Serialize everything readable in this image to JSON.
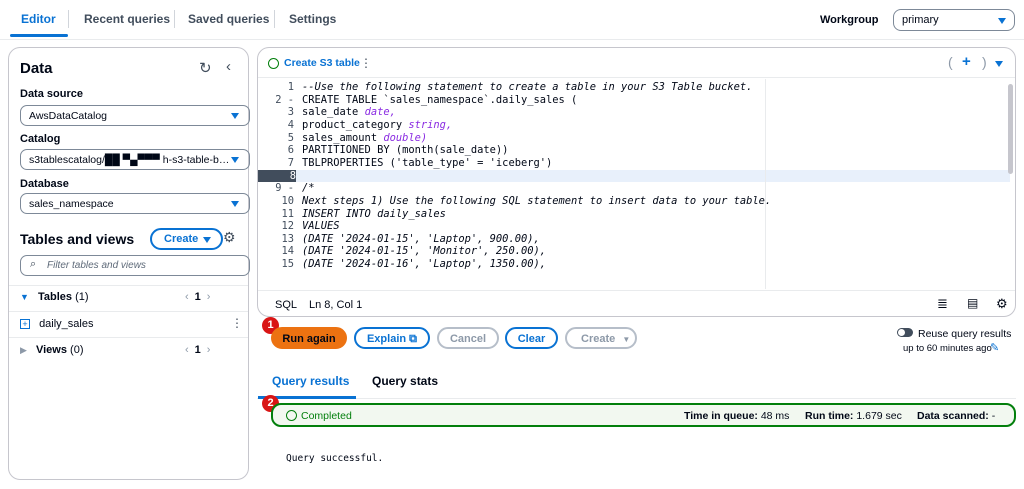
{
  "tabs": [
    "Editor",
    "Recent queries",
    "Saved queries",
    "Settings"
  ],
  "workgroup": {
    "label": "Workgroup",
    "value": "primary"
  },
  "left": {
    "title": "Data",
    "data_source_label": "Data source",
    "data_source": "AwsDataCatalog",
    "catalog_label": "Catalog",
    "catalog": "s3tablescatalog/██ ▀▄▀▀▀ h-s3-table-b…",
    "database_label": "Database",
    "database": "sales_namespace",
    "tables_views_title": "Tables and views",
    "create_label": "Create",
    "filter_placeholder": "Filter tables and views",
    "tables_label": "Tables",
    "tables_count": "(1)",
    "tables_page": "1",
    "table_item": "daily_sales",
    "views_label": "Views",
    "views_count": "(0)",
    "views_page": "1"
  },
  "editor": {
    "tab_label": "Create S3 table",
    "tab_menu": "⋮",
    "add_tab": "+",
    "lines": [
      {
        "n": "1",
        "text": "--Use the following statement to create a table in your S3 Table bucket."
      },
      {
        "n": "2 -",
        "text": "CREATE TABLE `sales_namespace`.daily_sales ("
      },
      {
        "n": "3",
        "text": "sale_date ",
        "type": "date,"
      },
      {
        "n": "4",
        "text": "product_category ",
        "type": "string,"
      },
      {
        "n": "5",
        "text": "sales_amount ",
        "type": "double)"
      },
      {
        "n": "6",
        "text": "PARTITIONED BY (month(sale_date))"
      },
      {
        "n": "7",
        "text": "TBLPROPERTIES ('table_type' = 'iceberg')"
      },
      {
        "n": "8",
        "text": ""
      },
      {
        "n": "9 -",
        "text": "/*"
      },
      {
        "n": "10",
        "text": "Next steps 1) Use the following SQL statement to insert data to your table."
      },
      {
        "n": "11",
        "text": "INSERT INTO daily_sales"
      },
      {
        "n": "12",
        "text": "VALUES"
      },
      {
        "n": "13",
        "text": "(DATE '2024-01-15', 'Laptop', 900.00),"
      },
      {
        "n": "14",
        "text": "(DATE '2024-01-15', 'Monitor', 250.00),"
      },
      {
        "n": "15",
        "text": "(DATE '2024-01-16', 'Laptop', 1350.00),"
      }
    ],
    "lang": "SQL",
    "cursor": "Ln 8, Col 1"
  },
  "actions": {
    "run": "Run again",
    "explain": "Explain",
    "cancel": "Cancel",
    "clear": "Clear",
    "create": "Create",
    "reuse_label": "Reuse query results",
    "reuse_sub": "up to 60 minutes ago",
    "badge1": "1",
    "badge2": "2"
  },
  "results": {
    "tab_results": "Query results",
    "tab_stats": "Query stats",
    "status": "Completed",
    "queue_label": "Time in queue:",
    "queue_value": "48 ms",
    "run_label": "Run time:",
    "run_value": "1.679 sec",
    "scanned_label": "Data scanned:",
    "scanned_value": "-",
    "message": "Query successful."
  }
}
